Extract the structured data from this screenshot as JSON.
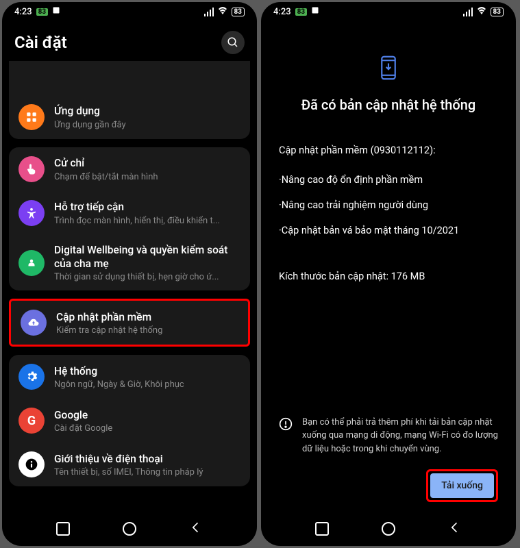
{
  "status": {
    "time": "4:23",
    "badge": "83",
    "battery": "83"
  },
  "left": {
    "headerTitle": "Cài đặt",
    "partialItemSubtitle": "",
    "items": [
      {
        "title": "Ứng dụng",
        "subtitle": "Ứng dụng gần đây",
        "color": "#ff7a1a",
        "icon": "apps"
      },
      {
        "title": "Cử chỉ",
        "subtitle": "Chạm để bật/tắt màn hình",
        "color": "#e84f8a",
        "icon": "gesture"
      },
      {
        "title": "Hỗ trợ tiếp cận",
        "subtitle": "Trình đọc màn hình, hiển thị, điều khiển t...",
        "color": "#7b3ff2",
        "icon": "accessibility"
      },
      {
        "title": "Digital Wellbeing và quyền kiểm soát của cha mẹ",
        "subtitle": "Thời gian sử dụng thiết bị, hẹn giờ cho ứ...",
        "color": "#1fb866",
        "icon": "wellbeing"
      },
      {
        "title": "Cập nhật phần mềm",
        "subtitle": "Kiểm tra cập nhật hệ thống",
        "color": "#6b70e0",
        "icon": "update",
        "highlight": true
      },
      {
        "title": "Hệ thống",
        "subtitle": "Ngôn ngữ, Ngày & Giờ, Khôi phục",
        "color": "#1a73e8",
        "icon": "system"
      },
      {
        "title": "Google",
        "subtitle": "Cài đặt Google",
        "color": "#ea4335",
        "icon": "google"
      },
      {
        "title": "Giới thiệu về điện thoại",
        "subtitle": "Tên thiết bị, số IMEI, Thông tin pháp lý",
        "color": "#1a1a1a",
        "icon": "info"
      }
    ]
  },
  "right": {
    "title": "Đã có bản cập nhật hệ thống",
    "version": "Cập nhật phần mềm (0930112112):",
    "bullets": [
      "·Nâng cao độ ổn định phần mềm",
      "·Nâng cao trải nghiệm người dùng",
      "·Cập nhật bản vá bảo mật tháng 10/2021"
    ],
    "size": "Kích thước bản cập nhật: 176 MB",
    "warning": "Bạn có thể phải trả thêm phí khi tải bản cập nhật xuống qua mạng di động, mạng Wi-Fi có đo lượng dữ liệu hoặc trong khi chuyển vùng.",
    "downloadLabel": "Tải xuống"
  }
}
